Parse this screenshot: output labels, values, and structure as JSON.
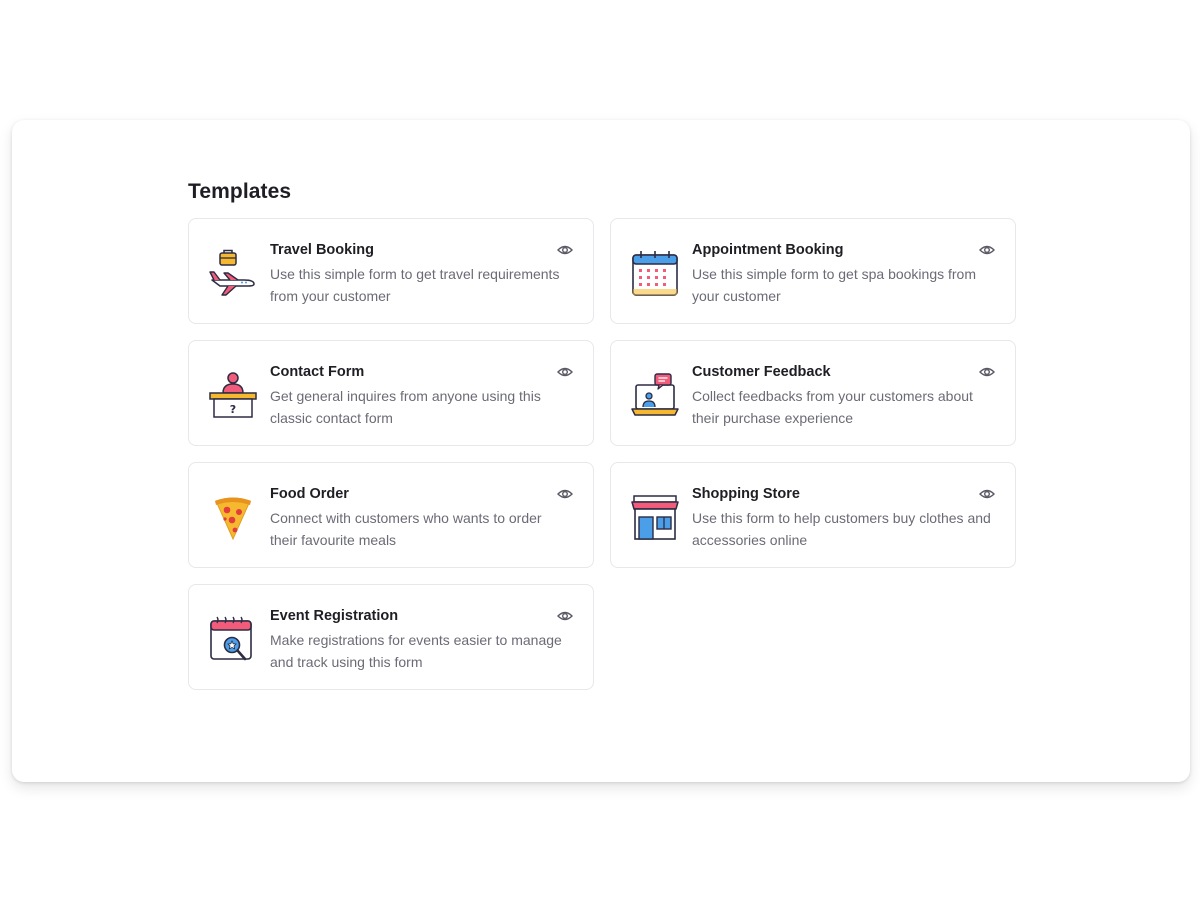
{
  "page": {
    "heading": "Templates"
  },
  "templates": [
    {
      "title": "Travel Booking",
      "description": "Use this simple form to get travel requirements from your customer",
      "icon": "airplane-luggage-icon"
    },
    {
      "title": "Appointment Booking",
      "description": "Use this simple form to get spa bookings from your customer",
      "icon": "calendar-icon"
    },
    {
      "title": "Contact Form",
      "description": "Get general inquires from anyone using this classic contact form",
      "icon": "help-desk-icon"
    },
    {
      "title": "Customer Feedback",
      "description": "Collect feedbacks from your customers about their purchase experience",
      "icon": "laptop-chat-icon"
    },
    {
      "title": "Food Order",
      "description": "Connect with customers who wants to order their favourite meals",
      "icon": "pizza-slice-icon"
    },
    {
      "title": "Shopping Store",
      "description": "Use this form to help customers buy clothes and accessories online",
      "icon": "storefront-icon"
    },
    {
      "title": "Event Registration",
      "description": "Make registrations for events easier to manage and track using this form",
      "icon": "event-calendar-icon"
    }
  ],
  "colors": {
    "text_primary": "#1e1e24",
    "text_secondary": "#6b6b76",
    "card_border": "#e7e7ec",
    "icon_outline": "#2c2c44",
    "accent_pink": "#f25c7a",
    "accent_blue": "#4a9fe8",
    "accent_yellow": "#f5b82e"
  }
}
